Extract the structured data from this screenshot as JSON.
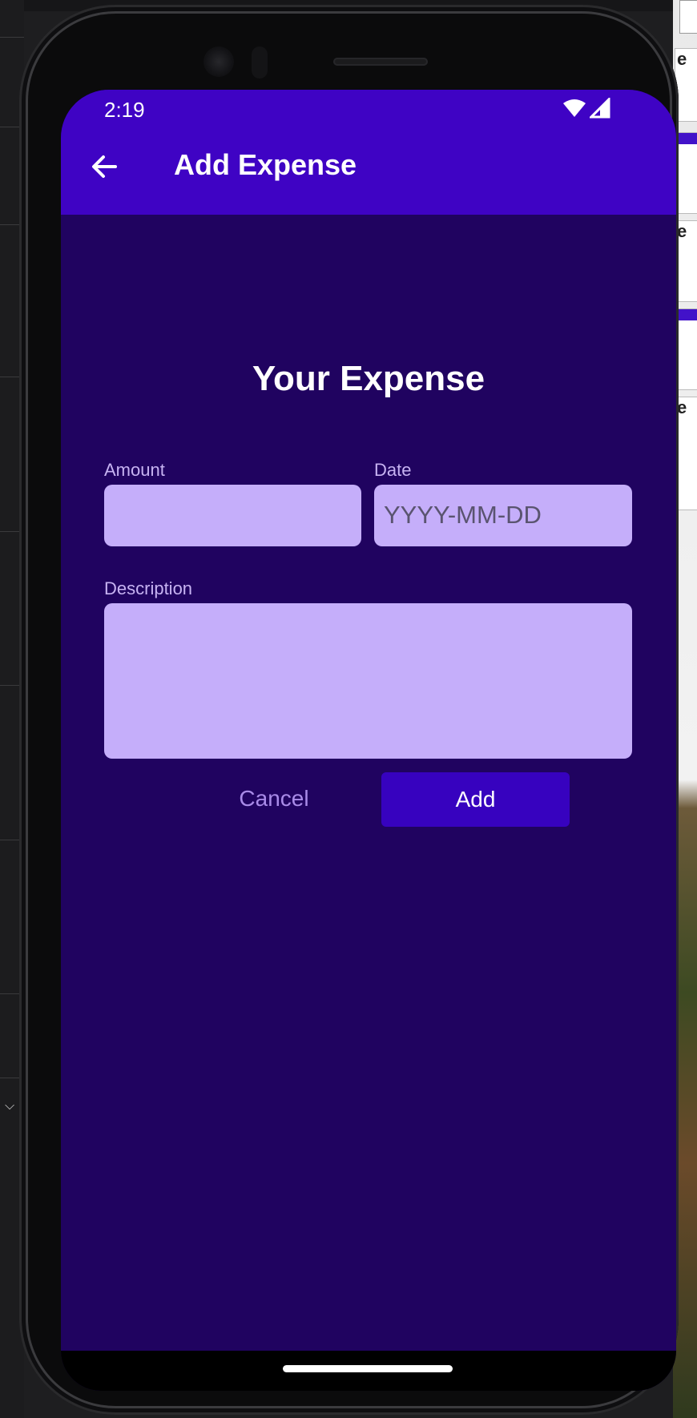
{
  "status_bar": {
    "time": "2:19"
  },
  "app_bar": {
    "title": "Add Expense",
    "back_icon": "arrow-left-icon"
  },
  "form": {
    "heading": "Your Expense",
    "amount_label": "Amount",
    "amount_value": "",
    "date_label": "Date",
    "date_placeholder": "YYYY-MM-DD",
    "description_label": "Description",
    "description_value": "",
    "cancel_label": "Cancel",
    "add_label": "Add"
  },
  "colors": {
    "app_bar": "#3f03c4",
    "screen_background": "#200360",
    "field_background": "#c5aefa",
    "label_text": "#c7b3f2",
    "primary_button": "#3702bf"
  }
}
